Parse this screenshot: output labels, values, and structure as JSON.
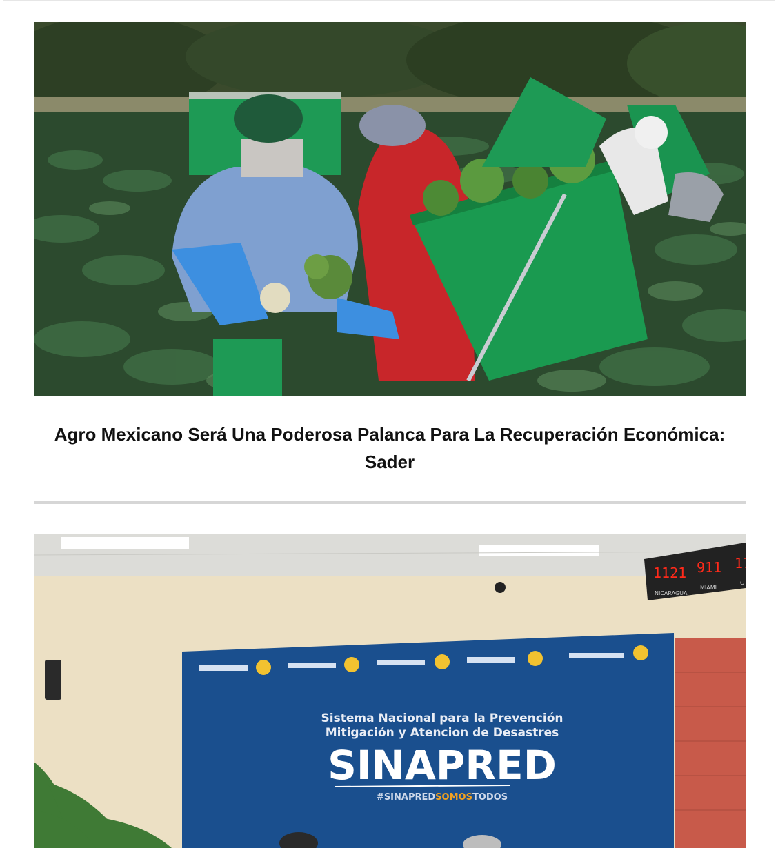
{
  "articles": [
    {
      "image_alt": "Agricultural workers harvesting broccoli in a field",
      "headline": "Agro Mexicano Será Una Poderosa Palanca Para La Recuperación Económica: Sader"
    },
    {
      "image_alt": "SINAPRED press conference room",
      "banner": {
        "line1": "Sistema Nacional para la Prevención",
        "line2": "Mitigación y Atencion de Desastres",
        "brand": "SINAPRED",
        "hashtag_prefix": "#SINAPRED",
        "hashtag_mid": "SOMOS",
        "hashtag_end": "TODOS"
      },
      "clocks": [
        {
          "time": "1121",
          "city": "NICARAGUA"
        },
        {
          "time": "911",
          "city": "MIAMI"
        },
        {
          "time": "17",
          "city": "G"
        }
      ]
    }
  ],
  "colors": {
    "field_green": "#2f5a34",
    "bag_green": "#1e9a55",
    "banner_blue": "#1a4f8e",
    "hashtag_orange": "#f0a020",
    "clock_red": "#ff2a1a"
  }
}
